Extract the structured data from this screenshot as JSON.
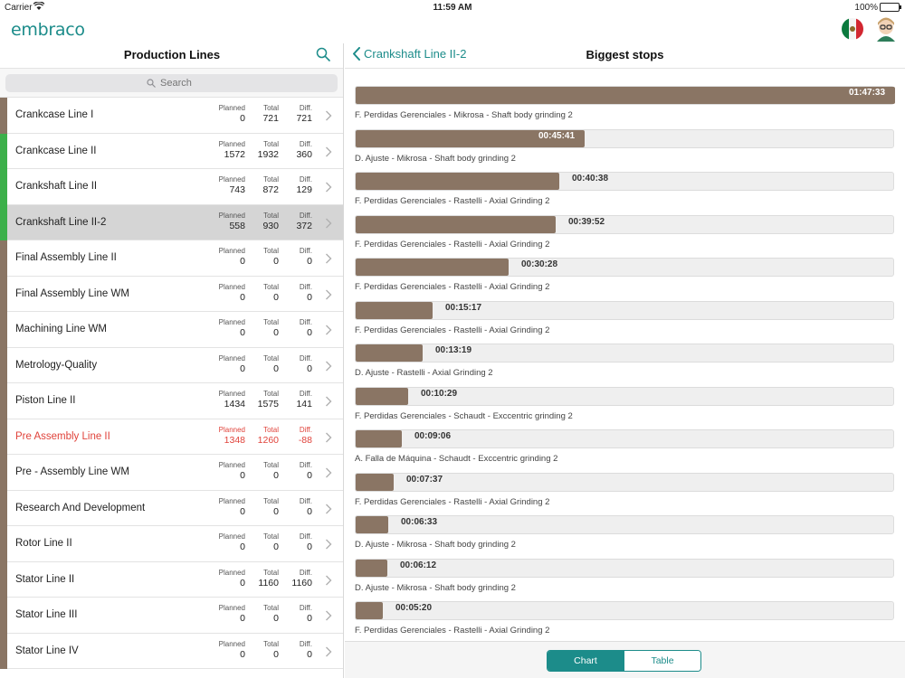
{
  "status_bar": {
    "carrier": "Carrier",
    "time": "11:59 AM",
    "battery": "100%"
  },
  "app": {
    "logo": "embraco"
  },
  "left": {
    "title": "Production Lines",
    "search_placeholder": "Search",
    "column_labels": {
      "planned": "Planned",
      "total": "Total",
      "diff": "Diff."
    },
    "lines": [
      {
        "name": "Crankcase Line I",
        "planned": "0",
        "total": "721",
        "diff": "721",
        "status_color": "#8a7564",
        "selected": false,
        "alert": false
      },
      {
        "name": "Crankcase Line II",
        "planned": "1572",
        "total": "1932",
        "diff": "360",
        "status_color": "#3cb04a",
        "selected": false,
        "alert": false
      },
      {
        "name": "Crankshaft Line II",
        "planned": "743",
        "total": "872",
        "diff": "129",
        "status_color": "#3cb04a",
        "selected": false,
        "alert": false
      },
      {
        "name": "Crankshaft Line II-2",
        "planned": "558",
        "total": "930",
        "diff": "372",
        "status_color": "#3cb04a",
        "selected": true,
        "alert": false
      },
      {
        "name": "Final Assembly Line II",
        "planned": "0",
        "total": "0",
        "diff": "0",
        "status_color": "#8a7564",
        "selected": false,
        "alert": false
      },
      {
        "name": "Final Assembly Line WM",
        "planned": "0",
        "total": "0",
        "diff": "0",
        "status_color": "#8a7564",
        "selected": false,
        "alert": false
      },
      {
        "name": "Machining Line WM",
        "planned": "0",
        "total": "0",
        "diff": "0",
        "status_color": "#8a7564",
        "selected": false,
        "alert": false
      },
      {
        "name": "Metrology-Quality",
        "planned": "0",
        "total": "0",
        "diff": "0",
        "status_color": "#8a7564",
        "selected": false,
        "alert": false
      },
      {
        "name": "Piston Line II",
        "planned": "1434",
        "total": "1575",
        "diff": "141",
        "status_color": "#8a7564",
        "selected": false,
        "alert": false
      },
      {
        "name": "Pre Assembly Line II",
        "planned": "1348",
        "total": "1260",
        "diff": "-88",
        "status_color": "#8a7564",
        "selected": false,
        "alert": true
      },
      {
        "name": "Pre - Assembly Line WM",
        "planned": "0",
        "total": "0",
        "diff": "0",
        "status_color": "#8a7564",
        "selected": false,
        "alert": false
      },
      {
        "name": "Research And Development",
        "planned": "0",
        "total": "0",
        "diff": "0",
        "status_color": "#8a7564",
        "selected": false,
        "alert": false
      },
      {
        "name": "Rotor Line II",
        "planned": "0",
        "total": "0",
        "diff": "0",
        "status_color": "#8a7564",
        "selected": false,
        "alert": false
      },
      {
        "name": "Stator Line II",
        "planned": "0",
        "total": "1160",
        "diff": "1160",
        "status_color": "#8a7564",
        "selected": false,
        "alert": false
      },
      {
        "name": "Stator Line III",
        "planned": "0",
        "total": "0",
        "diff": "0",
        "status_color": "#8a7564",
        "selected": false,
        "alert": false
      },
      {
        "name": "Stator Line IV",
        "planned": "0",
        "total": "0",
        "diff": "0",
        "status_color": "#8a7564",
        "selected": false,
        "alert": false
      }
    ]
  },
  "right": {
    "back_label": "Crankshaft Line II-2",
    "title": "Biggest stops",
    "bar_color": "#8a7564",
    "stops": [
      {
        "duration": "01:47:33",
        "fraction": 1.0,
        "label": "F. Perdidas Gerenciales - Mikrosa - Shaft body grinding 2"
      },
      {
        "duration": "00:45:41",
        "fraction": 0.425,
        "label": "D. Ajuste - Mikrosa - Shaft body grinding 2"
      },
      {
        "duration": "00:40:38",
        "fraction": 0.378,
        "label": "F. Perdidas Gerenciales - Rastelli - Axial Grinding 2"
      },
      {
        "duration": "00:39:52",
        "fraction": 0.371,
        "label": "F. Perdidas Gerenciales - Rastelli - Axial Grinding 2"
      },
      {
        "duration": "00:30:28",
        "fraction": 0.283,
        "label": "F. Perdidas Gerenciales - Rastelli - Axial Grinding 2"
      },
      {
        "duration": "00:15:17",
        "fraction": 0.142,
        "label": "F. Perdidas Gerenciales - Rastelli - Axial Grinding 2"
      },
      {
        "duration": "00:13:19",
        "fraction": 0.124,
        "label": "D. Ajuste - Rastelli - Axial Grinding 2"
      },
      {
        "duration": "00:10:29",
        "fraction": 0.097,
        "label": "F. Perdidas Gerenciales - Schaudt - Exccentric grinding 2"
      },
      {
        "duration": "00:09:06",
        "fraction": 0.085,
        "label": "A. Falla de Máquina - Schaudt - Exccentric grinding 2"
      },
      {
        "duration": "00:07:37",
        "fraction": 0.071,
        "label": "F. Perdidas Gerenciales - Rastelli - Axial Grinding 2"
      },
      {
        "duration": "00:06:33",
        "fraction": 0.061,
        "label": "D. Ajuste - Mikrosa - Shaft body grinding 2"
      },
      {
        "duration": "00:06:12",
        "fraction": 0.058,
        "label": "D. Ajuste - Mikrosa - Shaft body grinding 2"
      },
      {
        "duration": "00:05:20",
        "fraction": 0.05,
        "label": "F. Perdidas Gerenciales - Rastelli - Axial Grinding 2"
      }
    ]
  },
  "bottom": {
    "tabs": [
      {
        "label": "Chart",
        "active": true
      },
      {
        "label": "Table",
        "active": false
      }
    ]
  }
}
